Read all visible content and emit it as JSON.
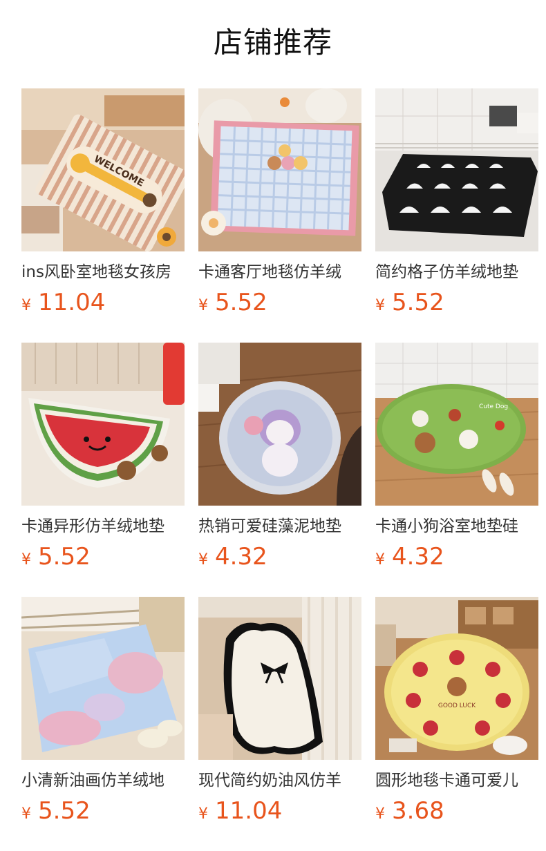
{
  "page": {
    "title": "店铺推荐"
  },
  "colors": {
    "price": "#e8541c",
    "title": "#111111",
    "text": "#333333"
  },
  "products": [
    {
      "name": "ins风卧室地毯女孩房",
      "currency": "¥",
      "price": "11.04",
      "image": "welcome-cat-striped-rug"
    },
    {
      "name": "卡通客厅地毯仿羊绒",
      "currency": "¥",
      "price": "5.52",
      "image": "pink-plaid-cartoon-rug"
    },
    {
      "name": "简约格子仿羊绒地垫",
      "currency": "¥",
      "price": "5.52",
      "image": "black-white-scale-pattern-mat"
    },
    {
      "name": "卡通异形仿羊绒地垫",
      "currency": "¥",
      "price": "5.52",
      "image": "watermelon-shaped-mat"
    },
    {
      "name": "热销可爱硅藻泥地垫",
      "currency": "¥",
      "price": "4.32",
      "image": "kuromi-oval-mat"
    },
    {
      "name": "卡通小狗浴室地垫硅",
      "currency": "¥",
      "price": "4.32",
      "image": "green-puppy-bath-mat"
    },
    {
      "name": "小清新油画仿羊绒地",
      "currency": "¥",
      "price": "5.52",
      "image": "oil-painting-pastel-rug"
    },
    {
      "name": "现代简约奶油风仿羊",
      "currency": "¥",
      "price": "11.04",
      "image": "cream-bow-wavy-rug"
    },
    {
      "name": "圆形地毯卡通可爱儿",
      "currency": "¥",
      "price": "3.68",
      "image": "round-yellow-bear-rug"
    }
  ]
}
